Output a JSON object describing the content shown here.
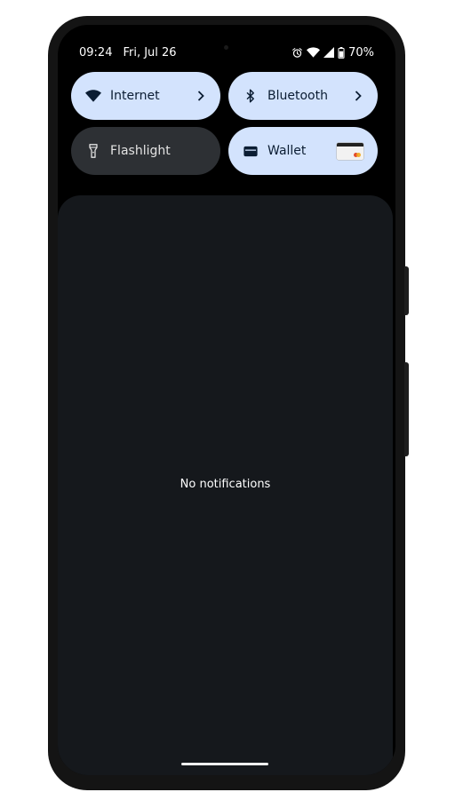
{
  "status_bar": {
    "time": "09:24",
    "date": "Fri, Jul 26",
    "battery": "70%",
    "icons": [
      "alarm-icon",
      "wifi-icon",
      "cell-signal-icon",
      "battery-icon"
    ]
  },
  "quick_settings": {
    "tiles": [
      {
        "label": "Internet",
        "icon": "wifi-icon",
        "state": "on",
        "has_chevron": true
      },
      {
        "label": "Bluetooth",
        "icon": "bluetooth-icon",
        "state": "on",
        "has_chevron": true
      },
      {
        "label": "Flashlight",
        "icon": "flashlight-icon",
        "state": "off",
        "has_chevron": false
      },
      {
        "label": "Wallet",
        "icon": "wallet-icon",
        "state": "on",
        "has_chevron": false
      }
    ]
  },
  "notifications": {
    "empty_text": "No notifications"
  },
  "colors": {
    "tile_on": "#d3e3fd",
    "tile_off": "#2d3034",
    "panel": "#15181c",
    "screen": "#000000"
  }
}
